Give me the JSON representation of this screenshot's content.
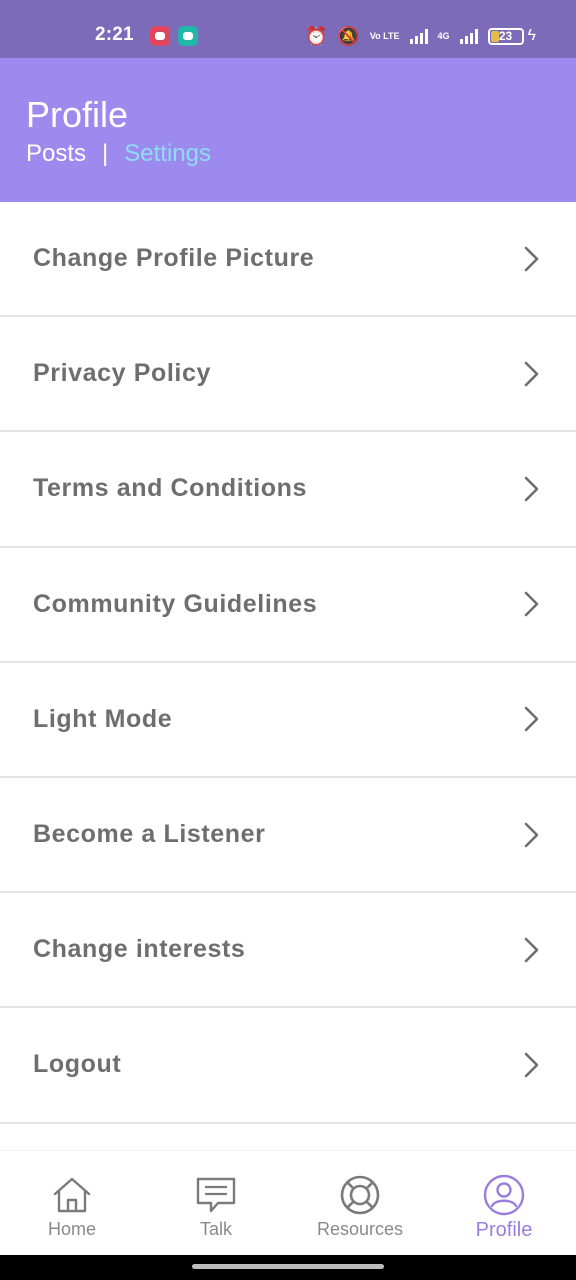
{
  "status_bar": {
    "time": "2:21",
    "battery_level": "23",
    "icons": [
      "screen-record-icon",
      "chat-notification-icon",
      "alarm-icon",
      "mute-icon",
      "volte-icon",
      "signal-icon",
      "4g-signal-icon",
      "battery-icon",
      "charging-icon"
    ],
    "volte_text": "Vo LTE",
    "network_text": "4G"
  },
  "header": {
    "title": "Profile",
    "tabs": [
      {
        "label": "Posts",
        "active": false
      },
      {
        "label": "Settings",
        "active": true
      }
    ],
    "separator": "|",
    "colors": {
      "background": "#9d8aef",
      "active_tab": "#8fdcf2"
    }
  },
  "settings": {
    "items": [
      {
        "label": "Change Profile Picture"
      },
      {
        "label": "Privacy Policy"
      },
      {
        "label": "Terms and Conditions"
      },
      {
        "label": "Community Guidelines"
      },
      {
        "label": "Light Mode"
      },
      {
        "label": "Become a Listener"
      },
      {
        "label": "Change interests"
      },
      {
        "label": "Logout"
      }
    ],
    "chevron_icon": "chevron-right-icon"
  },
  "bottom_nav": {
    "items": [
      {
        "label": "Home",
        "icon": "home-icon",
        "active": false
      },
      {
        "label": "Talk",
        "icon": "chat-bubble-icon",
        "active": false
      },
      {
        "label": "Resources",
        "icon": "lifebuoy-icon",
        "active": false
      },
      {
        "label": "Profile",
        "icon": "user-circle-icon",
        "active": true
      }
    ],
    "colors": {
      "active": "#9a7ddd",
      "inactive": "#8a8a8a"
    }
  }
}
